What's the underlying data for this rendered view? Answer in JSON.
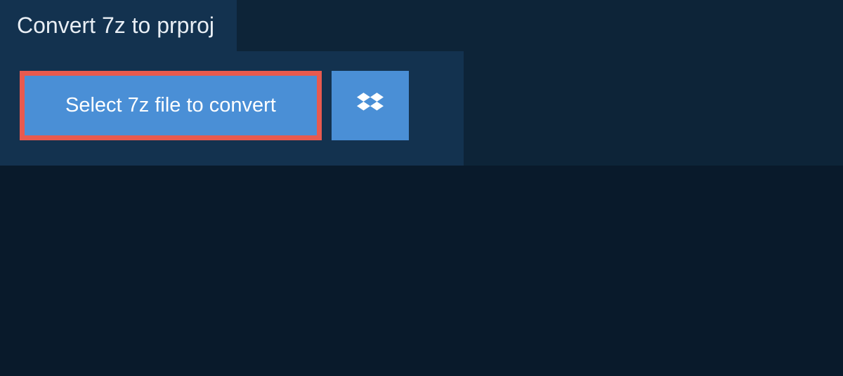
{
  "header": {
    "tab_title": "Convert 7z to prproj"
  },
  "actions": {
    "select_file_label": "Select 7z file to convert",
    "dropbox_icon": "dropbox-icon"
  },
  "colors": {
    "background_dark": "#0d2438",
    "panel": "#13324f",
    "button": "#4a8fd6",
    "highlight_border": "#e85a4f",
    "bottom": "#091a2b"
  }
}
